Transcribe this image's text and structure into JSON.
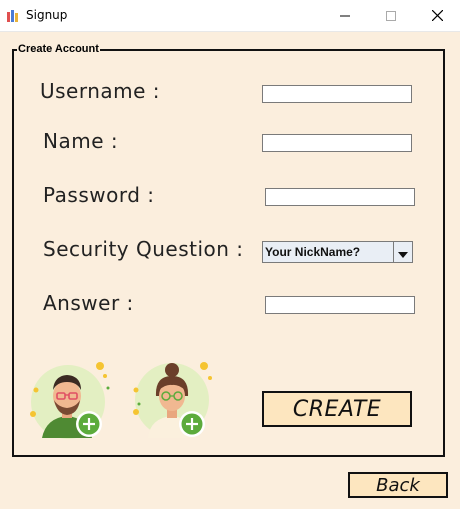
{
  "window": {
    "title": "Signup",
    "controls": [
      "minimize-icon",
      "maximize-icon",
      "close-icon"
    ]
  },
  "form": {
    "legend": "Create Account",
    "fields": {
      "username": {
        "label": "Username :",
        "value": ""
      },
      "name": {
        "label": "Name :",
        "value": ""
      },
      "password": {
        "label": "Password :",
        "value": ""
      },
      "security_question": {
        "label": "Security Question :",
        "selected": "Your NickName?"
      },
      "answer": {
        "label": "Answer :",
        "value": ""
      }
    },
    "avatars": [
      "male-avatar-add-icon",
      "female-avatar-add-icon"
    ],
    "create_label": "CREATE"
  },
  "back_label": "Back",
  "colors": {
    "background": "#fbeedd",
    "button": "#fde6bf",
    "avatar_circle": "#e3efc2",
    "add_badge": "#5cab3c",
    "male_shirt": "#4f8a33",
    "female_shirt": "#fbf0dd"
  }
}
